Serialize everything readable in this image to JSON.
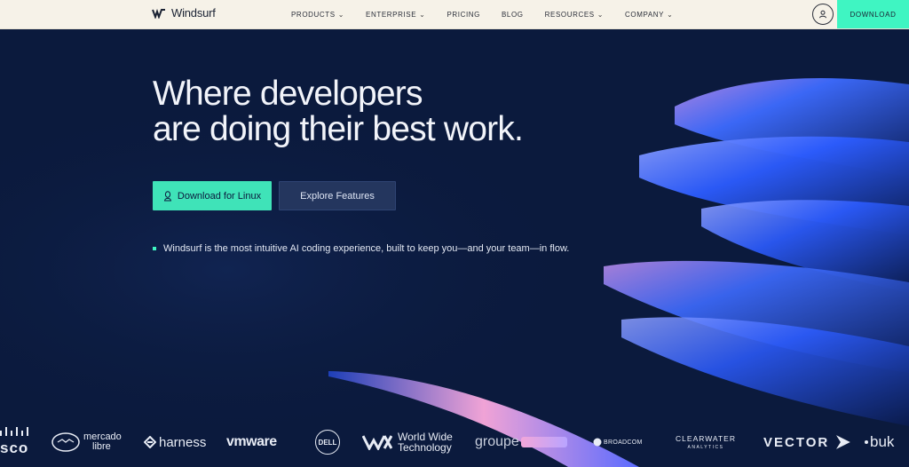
{
  "header": {
    "logo_text": "Windsurf",
    "nav": [
      {
        "label": "PRODUCTS",
        "has_caret": true
      },
      {
        "label": "ENTERPRISE",
        "has_caret": true
      },
      {
        "label": "PRICING",
        "has_caret": false
      },
      {
        "label": "BLOG",
        "has_caret": false
      },
      {
        "label": "RESOURCES",
        "has_caret": true
      },
      {
        "label": "COMPANY",
        "has_caret": true
      }
    ],
    "download_label": "DOWNLOAD"
  },
  "hero": {
    "title_line1": "Where developers",
    "title_line2": "are doing their best work.",
    "primary_cta": "Download for Linux",
    "secondary_cta": "Explore Features",
    "tagline": "Windsurf is the most intuitive AI coding experience, built to keep you—and your team—in flow."
  },
  "logos": {
    "cisco": "sco",
    "mercado_line1": "mercado",
    "mercado_line2": "libre",
    "harness": "harness",
    "vmware": "vmware",
    "dell": "DELL",
    "wwt_line1": "World Wide",
    "wwt_line2": "Technology",
    "groupe": "groupe",
    "broadcom": "BROADCOM",
    "clearwater_line1": "CLEARWATER",
    "clearwater_line2": "ANALYTICS",
    "vector": "VECTOR",
    "buk": "buk"
  },
  "colors": {
    "background": "#0b1a3d",
    "header_bg": "#f6f2e8",
    "accent_green": "#3ff5c2",
    "wave_blue": "#2f6bff"
  },
  "icons": {
    "logo": "windsurf-logo-icon",
    "user": "user-icon",
    "linux": "linux-penguin-icon"
  }
}
